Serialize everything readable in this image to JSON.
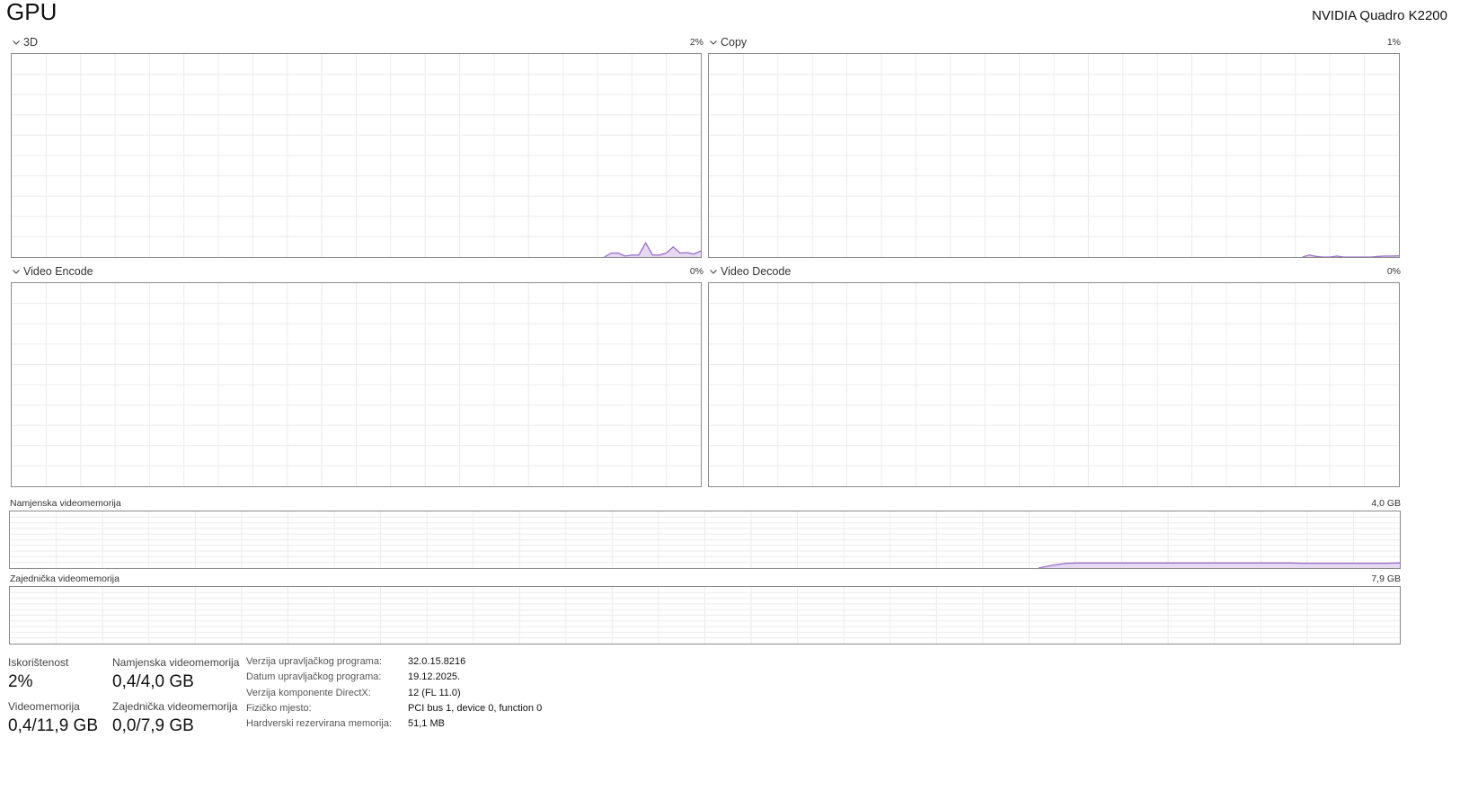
{
  "header": {
    "title": "GPU",
    "device_name": "NVIDIA Quadro K2200"
  },
  "colors": {
    "accent_line": "#9a6bc9",
    "accent_fill": "#e6d9f2",
    "grid": "#ececec",
    "border": "#8a8a8a"
  },
  "engines": [
    {
      "label": "3D",
      "percent": "2%",
      "history": [
        0,
        0,
        0,
        0,
        0,
        0,
        0,
        0,
        0,
        0,
        0,
        0,
        0,
        0,
        0,
        0,
        0,
        0,
        0,
        0,
        0,
        0,
        0,
        0,
        0,
        0,
        0,
        0,
        0,
        0,
        0,
        0,
        0,
        0,
        0,
        0,
        0,
        0,
        0,
        0,
        0,
        0,
        0,
        0,
        0,
        0,
        0,
        0,
        0,
        0,
        0,
        0,
        0,
        0,
        0,
        0,
        0,
        0,
        0,
        0,
        0,
        0,
        0,
        0,
        0,
        0,
        0,
        0,
        0,
        0,
        0,
        0,
        0,
        0,
        0,
        0,
        0,
        0,
        0,
        0,
        0,
        0,
        0,
        0,
        0,
        0,
        0,
        2,
        2,
        0.5,
        1,
        1,
        7,
        1,
        1,
        2,
        5,
        2,
        2.2,
        1.5,
        3
      ]
    },
    {
      "label": "Copy",
      "percent": "1%",
      "history": [
        0,
        0,
        0,
        0,
        0,
        0,
        0,
        0,
        0,
        0,
        0,
        0,
        0,
        0,
        0,
        0,
        0,
        0,
        0,
        0,
        0,
        0,
        0,
        0,
        0,
        0,
        0,
        0,
        0,
        0,
        0,
        0,
        0,
        0,
        0,
        0,
        0,
        0,
        0,
        0,
        0,
        0,
        0,
        0,
        0,
        0,
        0,
        0,
        0,
        0,
        0,
        0,
        0,
        0,
        0,
        0,
        0,
        0,
        0,
        0,
        0,
        0,
        0,
        0,
        0,
        0,
        0,
        0,
        0,
        0,
        0,
        0,
        0,
        0,
        0,
        0,
        0,
        0,
        0,
        0,
        0,
        0,
        0,
        0,
        0,
        0,
        0,
        1,
        0.3,
        0,
        0,
        0.5,
        0,
        0,
        0,
        0,
        0,
        0.3,
        0.5,
        0.5,
        0.6
      ]
    },
    {
      "label": "Video Encode",
      "percent": "0%",
      "history": []
    },
    {
      "label": "Video Decode",
      "percent": "0%",
      "history": []
    }
  ],
  "memory_graphs": [
    {
      "label": "Namjenska videomemorija",
      "max": "4,0 GB",
      "history": [
        0,
        0,
        0,
        0,
        0,
        0,
        0,
        0,
        0,
        0,
        0,
        0,
        0,
        0,
        0,
        0,
        0,
        0,
        0,
        0,
        0,
        0,
        0,
        0,
        0,
        0,
        0,
        0,
        0,
        0,
        0,
        0,
        0,
        0,
        0,
        0,
        0,
        0,
        0,
        0,
        0,
        0,
        0,
        0,
        0,
        0,
        0,
        0,
        0,
        0,
        0,
        0,
        0,
        0,
        0,
        0,
        0,
        0,
        0,
        0,
        0,
        0,
        0,
        0,
        0,
        0,
        0,
        0,
        0,
        0,
        0,
        0,
        0,
        0,
        0,
        0.05,
        0.085,
        0.09,
        0.09,
        0.09,
        0.09,
        0.09,
        0.09,
        0.09,
        0.09,
        0.09,
        0.09,
        0.09,
        0.09,
        0.09,
        0.09,
        0.09,
        0.09,
        0.085,
        0.085,
        0.085,
        0.085,
        0.085,
        0.085,
        0.085,
        0.09
      ]
    },
    {
      "label": "Zajednička videomemorija",
      "max": "7,9 GB",
      "history": []
    }
  ],
  "stats": [
    {
      "label": "Iskorištenost",
      "value": "2%"
    },
    {
      "label": "Namjenska videomemorija",
      "value": "0,4/4,0 GB"
    },
    {
      "label": "Videomemorija",
      "value": "0,4/11,9 GB"
    },
    {
      "label": "Zajednička videomemorija",
      "value": "0,0/7,9 GB"
    }
  ],
  "info": [
    {
      "label": "Verzija upravljačkog programa:",
      "value": "32.0.15.8216"
    },
    {
      "label": "Datum upravljačkog programa:",
      "value": "19.12.2025."
    },
    {
      "label": "Verzija komponente DirectX:",
      "value": "12 (FL 11.0)"
    },
    {
      "label": "Fizičko mjesto:",
      "value": "PCI bus 1, device 0, function 0"
    },
    {
      "label": "Hardverski rezervirana memorija:",
      "value": "51,1 MB"
    }
  ]
}
